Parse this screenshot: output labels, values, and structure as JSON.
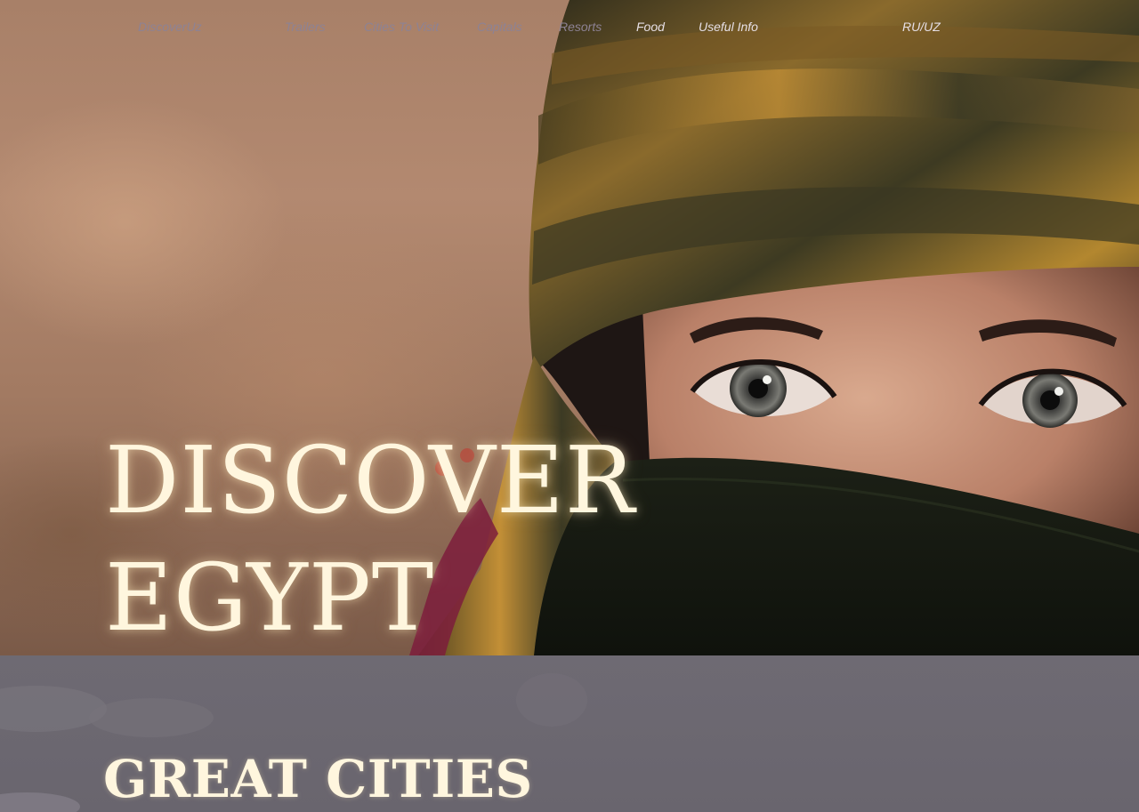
{
  "nav": {
    "brand": "DiscoverUz",
    "links": [
      "Trailers",
      "Cities To Visit",
      "Capitals",
      "Resorts",
      "Food",
      "Useful Info"
    ],
    "language": "RU/UZ"
  },
  "hero": {
    "title_line1": "DISCOVER",
    "title_line2": "EGYPT",
    "image": "hero-woman-with-headscarf-photo"
  },
  "section": {
    "title": "GREAT CITIES"
  },
  "colors": {
    "headline": "#fff6de",
    "nav_dim": "#8d8294",
    "nav_light": "#e6dfe5",
    "section_bg": "#6b6770"
  }
}
